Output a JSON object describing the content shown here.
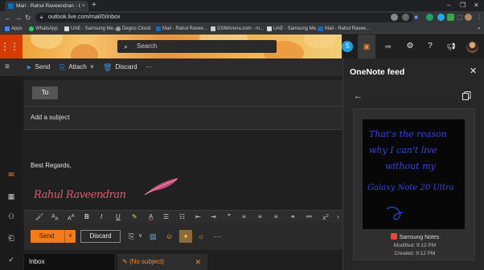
{
  "browser": {
    "tab_title": "Mail - Rahul Raveendran - Outlo",
    "url": "outlook.live.com/mail/0/inbox",
    "bookmarks": [
      "Apps",
      "WhatsApp",
      "UAE - Samsung Me...",
      "Degoo Cloud",
      "Mail - Rahul Ravee...",
      "GSMArena.com - m...",
      "UAE - Samsung Me...",
      "Mail - Rahul Ravee..."
    ]
  },
  "header": {
    "search_placeholder": "Search"
  },
  "toolbar": {
    "send_label": "Send",
    "attach_label": "Attach",
    "discard_label": "Discard",
    "more_label": "···"
  },
  "compose": {
    "to_label": "To",
    "subject_placeholder": "Add a subject",
    "body_text": "Best Regards,",
    "signature_text": "Rahul Raveendran",
    "send_button": "Send",
    "discard_button": "Discard"
  },
  "tabs": {
    "inbox_label": "Inbox",
    "draft_label": "(No subject)"
  },
  "onenote": {
    "title": "OneNote feed",
    "note_lines": [
      "That's the reason",
      "why I can't live",
      "without my",
      "Galaxy Note 20 Ultra"
    ],
    "app_name": "Samsung Notes",
    "modified": "Modified: 9:12 PM",
    "created": "Created: 9:12 PM"
  },
  "colors": {
    "accent": "#f27c1b",
    "waffle": "#d83b01",
    "link_blue": "#3d8fd6",
    "ink_blue": "#3347e0"
  }
}
